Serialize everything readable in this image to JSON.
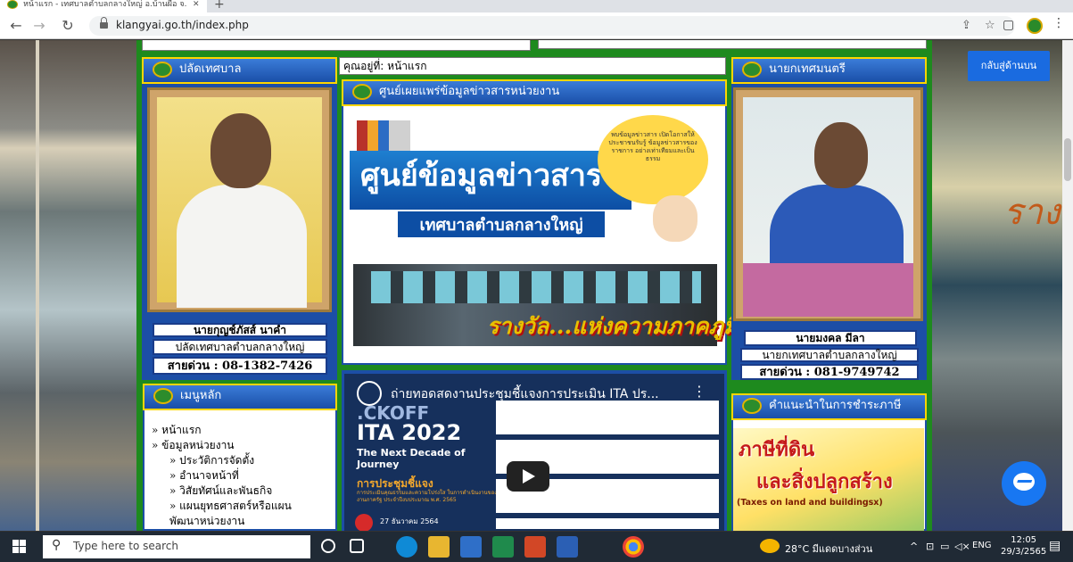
{
  "browser": {
    "tab_title": "หน้าแรก - เทศบาลตำบลกลางใหญ่ อ.บ้านผือ จ.",
    "url": "klangyai.go.th/index.php"
  },
  "breadcrumb": "คุณอยู่ที่: หน้าแรก",
  "left_panel": {
    "title": "ปลัดเทศบาล",
    "name": "นายกุญช์ภัสส์ นาคำ",
    "position": "ปลัดเทศบาลตำบลกลางใหญ่",
    "hotline": "สายด่วน : 08-1382-7426"
  },
  "center_panel": {
    "title": "ศูนย์เผยแพร่ข้อมูลข่าวสารหน่วยงาน",
    "banner_title": "ศูนย์ข้อมูลข่าวสาร",
    "banner_subtitle": "เทศบาลตำบลกลางใหญ่",
    "banner_quote": "พบข้อมูลข่าวสาร เปิดโอกาสให้ประชาชนรับรู้ ข้อมูลข่าวสารของราชการ อย่างเท่าเทียมและเป็นธรรม",
    "award_text": "รางวัล...แห่งความภาคภูมิใจ"
  },
  "video": {
    "title": "ถ่ายทอดสดงานประชุมชี้แจงการประเมิน ITA ปร...",
    "kickoff": ".CKOFF",
    "ita": "ITA 2022",
    "tagline": "The Next Decade of Journey",
    "sub": "การประชุมชี้แจง",
    "desc": "การประเมินคุณธรรมและความโปร่งใส ในการดำเนินงานของหน่วยงานภาครัฐ ประจำปีงบประมาณ พ.ศ. 2565",
    "date": "27 ธันวาคม 2564"
  },
  "menu": {
    "title": "เมนูหลัก",
    "items": [
      {
        "label": "» หน้าแรก",
        "sub": false
      },
      {
        "label": "» ข้อมูลหน่วยงาน",
        "sub": false
      },
      {
        "label": "» ประวัติการจัดตั้ง",
        "sub": true
      },
      {
        "label": "» อำนาจหน้าที่",
        "sub": true
      },
      {
        "label": "» วิสัยทัศน์และพันธกิจ",
        "sub": true
      },
      {
        "label": "» แผนยุทธศาสตร์หรือแผน",
        "sub": true
      },
      {
        "label": "พัฒนาหน่วยงาน",
        "sub": true
      }
    ]
  },
  "right_panel": {
    "title": "นายกเทศมนตรี",
    "name": "นายมงคล มีลา",
    "position": "นายกเทศบาลตำบลกลางใหญ่",
    "hotline": "สายด่วน : 081-9749742"
  },
  "tax_panel": {
    "title": "คำแนะนำในการชำระภาษี",
    "line1": "ภาษีที่ดิน",
    "line2": "และสิ่งปลูกสร้าง",
    "line3": "(Taxes on land and buildingsx)"
  },
  "back_to_top": "กลับสู่ด้านบน",
  "bg_right_text": "รางวัล",
  "taskbar": {
    "search_placeholder": "Type here to search",
    "weather": "28°C มีแดดบางส่วน",
    "lang": "ENG",
    "time": "12:05",
    "date": "29/3/2565"
  },
  "colors": {
    "header_blue": "#1c4ea6",
    "frame_green": "#1e8a1e",
    "header_border": "#ffd600",
    "taskbar": "#202a35"
  }
}
